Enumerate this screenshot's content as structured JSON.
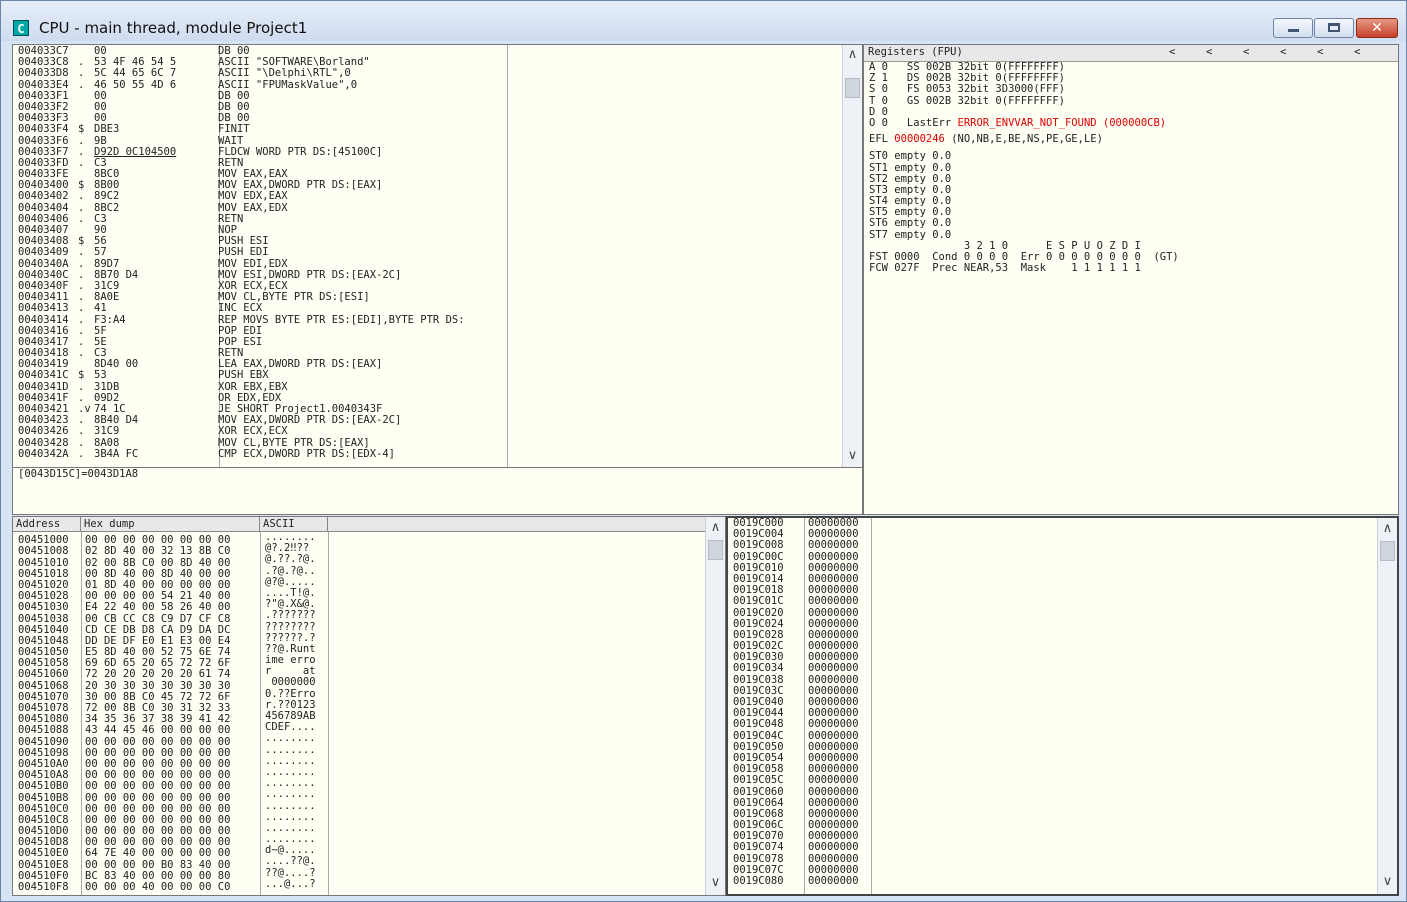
{
  "window": {
    "title": "CPU - main thread, module Project1",
    "app_icon_letter": "C",
    "close_glyph": "✕"
  },
  "disasm": {
    "rows": [
      {
        "addr": "004033C7",
        "m": " ",
        "hex": "00",
        "cmd": "DB 00"
      },
      {
        "addr": "004033C8",
        "m": ".",
        "hex": "53 4F 46 54 5",
        "cmd": "ASCII \"SOFTWARE\\Borland\""
      },
      {
        "addr": "004033D8",
        "m": ".",
        "hex": "5C 44 65 6C 7",
        "cmd": "ASCII \"\\Delphi\\RTL\",0"
      },
      {
        "addr": "004033E4",
        "m": ".",
        "hex": "46 50 55 4D 6",
        "cmd": "ASCII \"FPUMaskValue\",0"
      },
      {
        "addr": "004033F1",
        "m": " ",
        "hex": "00",
        "cmd": "DB 00"
      },
      {
        "addr": "004033F2",
        "m": " ",
        "hex": "00",
        "cmd": "DB 00"
      },
      {
        "addr": "004033F3",
        "m": " ",
        "hex": "00",
        "cmd": "DB 00"
      },
      {
        "addr": "004033F4",
        "m": "$",
        "hex": "DBE3",
        "cmd": "FINIT"
      },
      {
        "addr": "004033F6",
        "m": ".",
        "hex": "9B",
        "cmd": "WAIT"
      },
      {
        "addr": "004033F7",
        "m": ".",
        "hex": "D92D 0C104500",
        "cmd": "FLDCW WORD PTR DS:[45100C]"
      },
      {
        "addr": "004033FD",
        "m": ".",
        "hex": "C3",
        "cmd": "RETN"
      },
      {
        "addr": "004033FE",
        "m": " ",
        "hex": "8BC0",
        "cmd": "MOV EAX,EAX"
      },
      {
        "addr": "00403400",
        "m": "$",
        "hex": "8B00",
        "cmd": "MOV EAX,DWORD PTR DS:[EAX]"
      },
      {
        "addr": "00403402",
        "m": ".",
        "hex": "89C2",
        "cmd": "MOV EDX,EAX"
      },
      {
        "addr": "00403404",
        "m": ".",
        "hex": "8BC2",
        "cmd": "MOV EAX,EDX"
      },
      {
        "addr": "00403406",
        "m": ".",
        "hex": "C3",
        "cmd": "RETN"
      },
      {
        "addr": "00403407",
        "m": " ",
        "hex": "90",
        "cmd": "NOP"
      },
      {
        "addr": "00403408",
        "m": "$",
        "hex": "56",
        "cmd": "PUSH ESI"
      },
      {
        "addr": "00403409",
        "m": ".",
        "hex": "57",
        "cmd": "PUSH EDI"
      },
      {
        "addr": "0040340A",
        "m": ".",
        "hex": "89D7",
        "cmd": "MOV EDI,EDX"
      },
      {
        "addr": "0040340C",
        "m": ".",
        "hex": "8B70 D4",
        "cmd": "MOV ESI,DWORD PTR DS:[EAX-2C]"
      },
      {
        "addr": "0040340F",
        "m": ".",
        "hex": "31C9",
        "cmd": "XOR ECX,ECX"
      },
      {
        "addr": "00403411",
        "m": ".",
        "hex": "8A0E",
        "cmd": "MOV CL,BYTE PTR DS:[ESI]"
      },
      {
        "addr": "00403413",
        "m": ".",
        "hex": "41",
        "cmd": "INC ECX"
      },
      {
        "addr": "00403414",
        "m": ".",
        "hex": "F3:A4",
        "cmd": "REP MOVS BYTE PTR ES:[EDI],BYTE PTR DS:"
      },
      {
        "addr": "00403416",
        "m": ".",
        "hex": "5F",
        "cmd": "POP EDI"
      },
      {
        "addr": "00403417",
        "m": ".",
        "hex": "5E",
        "cmd": "POP ESI"
      },
      {
        "addr": "00403418",
        "m": ".",
        "hex": "C3",
        "cmd": "RETN"
      },
      {
        "addr": "00403419",
        "m": " ",
        "hex": "8D40 00",
        "cmd": "LEA EAX,DWORD PTR DS:[EAX]"
      },
      {
        "addr": "0040341C",
        "m": "$",
        "hex": "53",
        "cmd": "PUSH EBX"
      },
      {
        "addr": "0040341D",
        "m": ".",
        "hex": "31DB",
        "cmd": "XOR EBX,EBX"
      },
      {
        "addr": "0040341F",
        "m": ".",
        "hex": "09D2",
        "cmd": "OR EDX,EDX"
      },
      {
        "addr": "00403421",
        "m": ".v",
        "hex": "74 1C",
        "cmd": "JE SHORT Project1.0040343F"
      },
      {
        "addr": "00403423",
        "m": ".",
        "hex": "8B40 D4",
        "cmd": "MOV EAX,DWORD PTR DS:[EAX-2C]"
      },
      {
        "addr": "00403426",
        "m": ".",
        "hex": "31C9",
        "cmd": "XOR ECX,ECX"
      },
      {
        "addr": "00403428",
        "m": ".",
        "hex": "8A08",
        "cmd": "MOV CL,BYTE PTR DS:[EAX]"
      },
      {
        "addr": "0040342A",
        "m": ".",
        "hex": "3B4A FC",
        "cmd": "CMP ECX,DWORD PTR DS:[EDX-4]"
      }
    ],
    "info": "[0043D15C]=0043D1A8"
  },
  "registers": {
    "header": "Registers (FPU)",
    "arrows": [
      "<",
      "<",
      "<",
      "<",
      "<",
      "<"
    ],
    "flags": [
      "A 0   SS 002B 32bit 0(FFFFFFFF)",
      "Z 1   DS 002B 32bit 0(FFFFFFFF)",
      "S 0   FS 0053 32bit 3D3000(FFF)",
      "T 0   GS 002B 32bit 0(FFFFFFFF)",
      "D 0"
    ],
    "lasterr_prefix": "O 0   LastErr ",
    "lasterr_value": "ERROR_ENVVAR_NOT_FOUND (000000CB)",
    "efl_label": "EFL ",
    "efl_value": "00000246",
    "efl_desc": " (NO,NB,E,BE,NS,PE,GE,LE)",
    "st": [
      "ST0 empty 0.0",
      "ST1 empty 0.0",
      "ST2 empty 0.0",
      "ST3 empty 0.0",
      "ST4 empty 0.0",
      "ST5 empty 0.0",
      "ST6 empty 0.0",
      "ST7 empty 0.0"
    ],
    "fpu_bits_header": "               3 2 1 0      E S P U O Z D I",
    "fst": "FST 0000  Cond 0 0 0 0  Err 0 0 0 0 0 0 0 0  (GT)",
    "fcw": "FCW 027F  Prec NEAR,53  Mask    1 1 1 1 1 1"
  },
  "dump": {
    "col_address": "Address",
    "col_hex": "Hex dump",
    "col_ascii": "ASCII",
    "rows": [
      [
        "00451000",
        "00 00 00 00 00 00 00 00",
        "........"
      ],
      [
        "00451008",
        "02 8D 40 00 32 13 8B C0",
        "@?.2‼??"
      ],
      [
        "00451010",
        "02 00 8B C0 00 8D 40 00",
        "@.??.?@."
      ],
      [
        "00451018",
        "00 8D 40 00 8D 40 00 00",
        ".?@.?@.."
      ],
      [
        "00451020",
        "01 8D 40 00 00 00 00 00",
        "@?@....."
      ],
      [
        "00451028",
        "00 00 00 00 54 21 40 00",
        "....T!@."
      ],
      [
        "00451030",
        "E4 22 40 00 58 26 40 00",
        "?\"@.X&@."
      ],
      [
        "00451038",
        "00 CB CC C8 C9 D7 CF C8",
        ".???????"
      ],
      [
        "00451040",
        "CD CE DB D8 CA D9 DA DC",
        "????????"
      ],
      [
        "00451048",
        "DD DE DF E0 E1 E3 00 E4",
        "??????.?"
      ],
      [
        "00451050",
        "E5 8D 40 00 52 75 6E 74",
        "??@.Runt"
      ],
      [
        "00451058",
        "69 6D 65 20 65 72 72 6F",
        "ime erro"
      ],
      [
        "00451060",
        "72 20 20 20 20 20 61 74",
        "r     at"
      ],
      [
        "00451068",
        "20 30 30 30 30 30 30 30",
        " 0000000"
      ],
      [
        "00451070",
        "30 00 8B C0 45 72 72 6F",
        "0.??Erro"
      ],
      [
        "00451078",
        "72 00 8B C0 30 31 32 33",
        "r.??0123"
      ],
      [
        "00451080",
        "34 35 36 37 38 39 41 42",
        "456789AB"
      ],
      [
        "00451088",
        "43 44 45 46 00 00 00 00",
        "CDEF...."
      ],
      [
        "00451090",
        "00 00 00 00 00 00 00 00",
        "........"
      ],
      [
        "00451098",
        "00 00 00 00 00 00 00 00",
        "........"
      ],
      [
        "004510A0",
        "00 00 00 00 00 00 00 00",
        "........"
      ],
      [
        "004510A8",
        "00 00 00 00 00 00 00 00",
        "........"
      ],
      [
        "004510B0",
        "00 00 00 00 00 00 00 00",
        "........"
      ],
      [
        "004510B8",
        "00 00 00 00 00 00 00 00",
        "........"
      ],
      [
        "004510C0",
        "00 00 00 00 00 00 00 00",
        "........"
      ],
      [
        "004510C8",
        "00 00 00 00 00 00 00 00",
        "........"
      ],
      [
        "004510D0",
        "00 00 00 00 00 00 00 00",
        "........"
      ],
      [
        "004510D8",
        "00 00 00 00 00 00 00 00",
        "........"
      ],
      [
        "004510E0",
        "64 7E 40 00 00 00 00 00",
        "d~@....."
      ],
      [
        "004510E8",
        "00 00 00 00 B0 83 40 00",
        "....??@."
      ],
      [
        "004510F0",
        "BC 83 40 00 00 00 00 80",
        "??@....?"
      ],
      [
        "004510F8",
        "00 00 00 40 00 00 00 C0",
        "...@...?"
      ]
    ]
  },
  "stack": {
    "rows": [
      [
        "0019C000",
        "00000000"
      ],
      [
        "0019C004",
        "00000000"
      ],
      [
        "0019C008",
        "00000000"
      ],
      [
        "0019C00C",
        "00000000"
      ],
      [
        "0019C010",
        "00000000"
      ],
      [
        "0019C014",
        "00000000"
      ],
      [
        "0019C018",
        "00000000"
      ],
      [
        "0019C01C",
        "00000000"
      ],
      [
        "0019C020",
        "00000000"
      ],
      [
        "0019C024",
        "00000000"
      ],
      [
        "0019C028",
        "00000000"
      ],
      [
        "0019C02C",
        "00000000"
      ],
      [
        "0019C030",
        "00000000"
      ],
      [
        "0019C034",
        "00000000"
      ],
      [
        "0019C038",
        "00000000"
      ],
      [
        "0019C03C",
        "00000000"
      ],
      [
        "0019C040",
        "00000000"
      ],
      [
        "0019C044",
        "00000000"
      ],
      [
        "0019C048",
        "00000000"
      ],
      [
        "0019C04C",
        "00000000"
      ],
      [
        "0019C050",
        "00000000"
      ],
      [
        "0019C054",
        "00000000"
      ],
      [
        "0019C058",
        "00000000"
      ],
      [
        "0019C05C",
        "00000000"
      ],
      [
        "0019C060",
        "00000000"
      ],
      [
        "0019C064",
        "00000000"
      ],
      [
        "0019C068",
        "00000000"
      ],
      [
        "0019C06C",
        "00000000"
      ],
      [
        "0019C070",
        "00000000"
      ],
      [
        "0019C074",
        "00000000"
      ],
      [
        "0019C078",
        "00000000"
      ],
      [
        "0019C07C",
        "00000000"
      ],
      [
        "0019C080",
        "00000000"
      ]
    ]
  },
  "scroll": {
    "up": "∧",
    "down": "∨"
  }
}
